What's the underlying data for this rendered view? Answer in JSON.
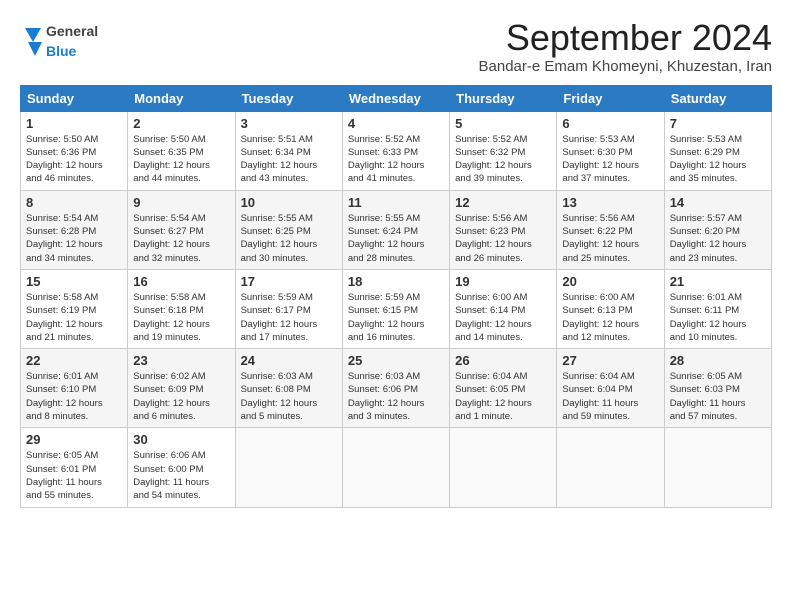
{
  "header": {
    "logo_general": "General",
    "logo_blue": "Blue",
    "month_title": "September 2024",
    "location": "Bandar-e Emam Khomeyni, Khuzestan, Iran"
  },
  "weekdays": [
    "Sunday",
    "Monday",
    "Tuesday",
    "Wednesday",
    "Thursday",
    "Friday",
    "Saturday"
  ],
  "weeks": [
    [
      {
        "day": "1",
        "info": "Sunrise: 5:50 AM\nSunset: 6:36 PM\nDaylight: 12 hours\nand 46 minutes."
      },
      {
        "day": "2",
        "info": "Sunrise: 5:50 AM\nSunset: 6:35 PM\nDaylight: 12 hours\nand 44 minutes."
      },
      {
        "day": "3",
        "info": "Sunrise: 5:51 AM\nSunset: 6:34 PM\nDaylight: 12 hours\nand 43 minutes."
      },
      {
        "day": "4",
        "info": "Sunrise: 5:52 AM\nSunset: 6:33 PM\nDaylight: 12 hours\nand 41 minutes."
      },
      {
        "day": "5",
        "info": "Sunrise: 5:52 AM\nSunset: 6:32 PM\nDaylight: 12 hours\nand 39 minutes."
      },
      {
        "day": "6",
        "info": "Sunrise: 5:53 AM\nSunset: 6:30 PM\nDaylight: 12 hours\nand 37 minutes."
      },
      {
        "day": "7",
        "info": "Sunrise: 5:53 AM\nSunset: 6:29 PM\nDaylight: 12 hours\nand 35 minutes."
      }
    ],
    [
      {
        "day": "8",
        "info": "Sunrise: 5:54 AM\nSunset: 6:28 PM\nDaylight: 12 hours\nand 34 minutes."
      },
      {
        "day": "9",
        "info": "Sunrise: 5:54 AM\nSunset: 6:27 PM\nDaylight: 12 hours\nand 32 minutes."
      },
      {
        "day": "10",
        "info": "Sunrise: 5:55 AM\nSunset: 6:25 PM\nDaylight: 12 hours\nand 30 minutes."
      },
      {
        "day": "11",
        "info": "Sunrise: 5:55 AM\nSunset: 6:24 PM\nDaylight: 12 hours\nand 28 minutes."
      },
      {
        "day": "12",
        "info": "Sunrise: 5:56 AM\nSunset: 6:23 PM\nDaylight: 12 hours\nand 26 minutes."
      },
      {
        "day": "13",
        "info": "Sunrise: 5:56 AM\nSunset: 6:22 PM\nDaylight: 12 hours\nand 25 minutes."
      },
      {
        "day": "14",
        "info": "Sunrise: 5:57 AM\nSunset: 6:20 PM\nDaylight: 12 hours\nand 23 minutes."
      }
    ],
    [
      {
        "day": "15",
        "info": "Sunrise: 5:58 AM\nSunset: 6:19 PM\nDaylight: 12 hours\nand 21 minutes."
      },
      {
        "day": "16",
        "info": "Sunrise: 5:58 AM\nSunset: 6:18 PM\nDaylight: 12 hours\nand 19 minutes."
      },
      {
        "day": "17",
        "info": "Sunrise: 5:59 AM\nSunset: 6:17 PM\nDaylight: 12 hours\nand 17 minutes."
      },
      {
        "day": "18",
        "info": "Sunrise: 5:59 AM\nSunset: 6:15 PM\nDaylight: 12 hours\nand 16 minutes."
      },
      {
        "day": "19",
        "info": "Sunrise: 6:00 AM\nSunset: 6:14 PM\nDaylight: 12 hours\nand 14 minutes."
      },
      {
        "day": "20",
        "info": "Sunrise: 6:00 AM\nSunset: 6:13 PM\nDaylight: 12 hours\nand 12 minutes."
      },
      {
        "day": "21",
        "info": "Sunrise: 6:01 AM\nSunset: 6:11 PM\nDaylight: 12 hours\nand 10 minutes."
      }
    ],
    [
      {
        "day": "22",
        "info": "Sunrise: 6:01 AM\nSunset: 6:10 PM\nDaylight: 12 hours\nand 8 minutes."
      },
      {
        "day": "23",
        "info": "Sunrise: 6:02 AM\nSunset: 6:09 PM\nDaylight: 12 hours\nand 6 minutes."
      },
      {
        "day": "24",
        "info": "Sunrise: 6:03 AM\nSunset: 6:08 PM\nDaylight: 12 hours\nand 5 minutes."
      },
      {
        "day": "25",
        "info": "Sunrise: 6:03 AM\nSunset: 6:06 PM\nDaylight: 12 hours\nand 3 minutes."
      },
      {
        "day": "26",
        "info": "Sunrise: 6:04 AM\nSunset: 6:05 PM\nDaylight: 12 hours\nand 1 minute."
      },
      {
        "day": "27",
        "info": "Sunrise: 6:04 AM\nSunset: 6:04 PM\nDaylight: 11 hours\nand 59 minutes."
      },
      {
        "day": "28",
        "info": "Sunrise: 6:05 AM\nSunset: 6:03 PM\nDaylight: 11 hours\nand 57 minutes."
      }
    ],
    [
      {
        "day": "29",
        "info": "Sunrise: 6:05 AM\nSunset: 6:01 PM\nDaylight: 11 hours\nand 55 minutes."
      },
      {
        "day": "30",
        "info": "Sunrise: 6:06 AM\nSunset: 6:00 PM\nDaylight: 11 hours\nand 54 minutes."
      },
      {
        "day": "",
        "info": ""
      },
      {
        "day": "",
        "info": ""
      },
      {
        "day": "",
        "info": ""
      },
      {
        "day": "",
        "info": ""
      },
      {
        "day": "",
        "info": ""
      }
    ]
  ]
}
